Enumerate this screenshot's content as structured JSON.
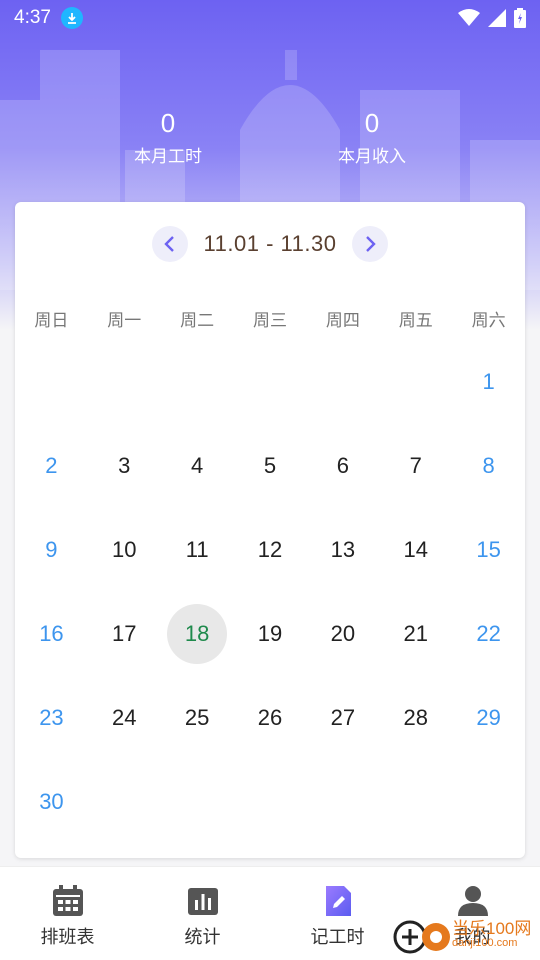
{
  "status_bar": {
    "time": "4:37"
  },
  "stats": [
    {
      "value": "0",
      "label": "本月工时"
    },
    {
      "value": "0",
      "label": "本月收入"
    }
  ],
  "calendar": {
    "range": "11.01 - 11.30",
    "weekdays": [
      "周日",
      "周一",
      "周二",
      "周三",
      "周四",
      "周五",
      "周六"
    ],
    "first_weekday_index": 6,
    "days_in_month": 30,
    "today": 18
  },
  "tabs": [
    {
      "label": "排班表",
      "icon": "calendar-icon"
    },
    {
      "label": "统计",
      "icon": "bar-chart-icon"
    },
    {
      "label": "记工时",
      "icon": "edit-document-icon"
    },
    {
      "label": "我的",
      "icon": "person-icon"
    }
  ],
  "watermark": {
    "text": "当乐100网",
    "url": "danji100.com"
  },
  "colors": {
    "accent": "#6d62f2",
    "weekend": "#3d95ee",
    "today": "#1f8a4c"
  }
}
